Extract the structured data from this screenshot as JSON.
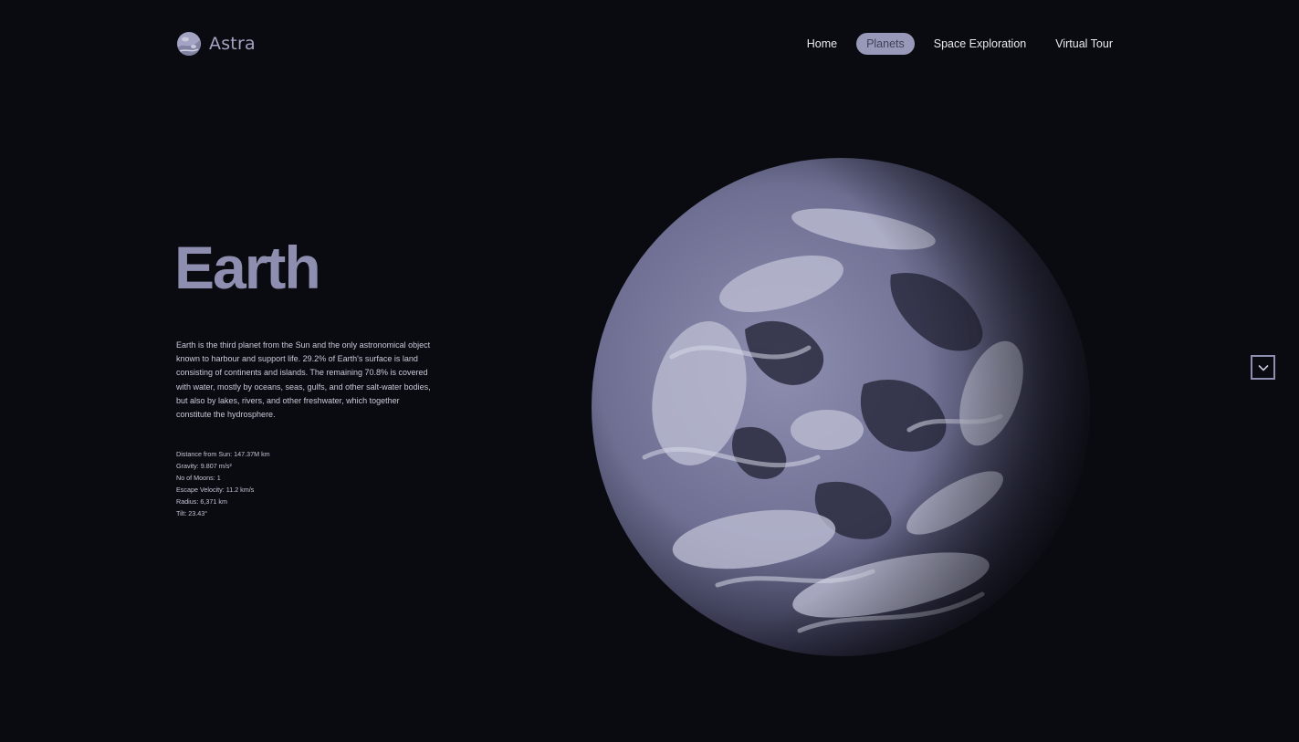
{
  "brand": {
    "name": "Astra",
    "icon": "planet-logo-icon"
  },
  "nav": {
    "items": [
      {
        "label": "Home",
        "active": false
      },
      {
        "label": "Planets",
        "active": true
      },
      {
        "label": "Space Exploration",
        "active": false
      },
      {
        "label": "Virtual Tour",
        "active": false
      }
    ]
  },
  "hero": {
    "title": "Earth",
    "description": "Earth is the third planet from the Sun and the only astronomical object known to harbour and support life. 29.2% of Earth's surface is land consisting of continents and islands. The remaining 70.8% is covered with water, mostly by oceans, seas, gulfs, and other salt-water bodies, but also by lakes, rivers, and other freshwater, which together constitute the hydrosphere.",
    "stats": [
      "Distance from Sun: 147.37M km",
      "Gravity: 9.807 m/s²",
      "No of Moons: 1",
      "Escape Velocity: 11.2 km/s",
      "Radius: 6,371 km",
      "Tilt: 23.43°"
    ]
  },
  "visual": {
    "planet_image": "earth-globe-image",
    "scroll_icon": "chevron-down-icon"
  },
  "colors": {
    "background": "#0a0b10",
    "accent": "#8e8fb0",
    "text": "#e9e9f2"
  }
}
